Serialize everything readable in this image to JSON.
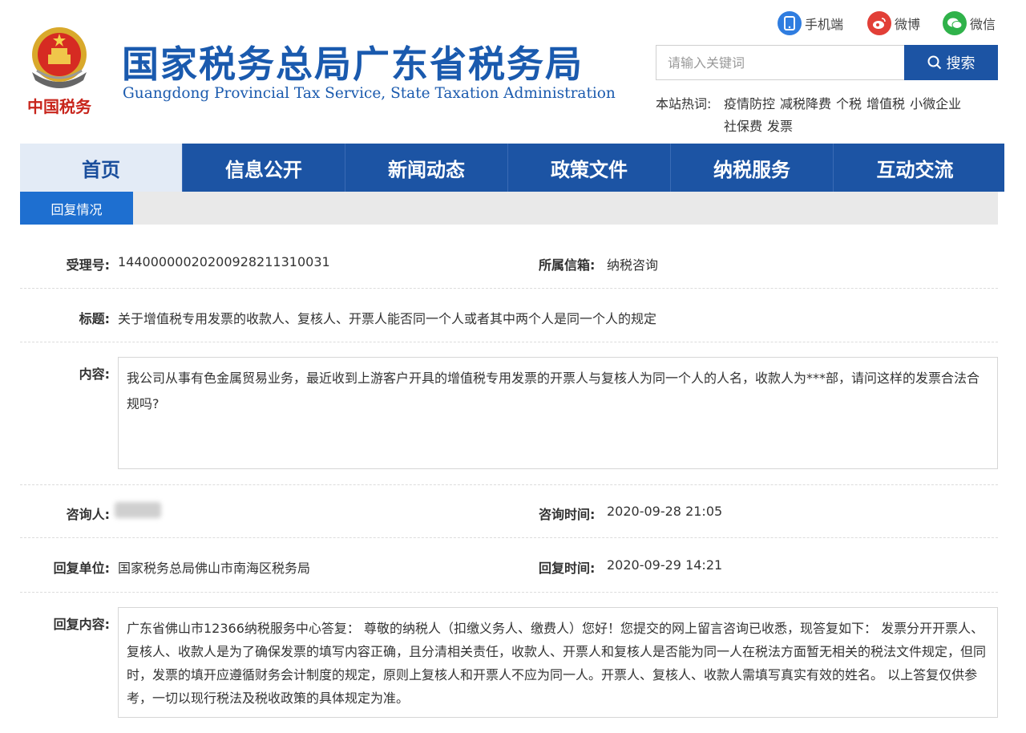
{
  "header": {
    "title_cn": "国家税务总局广东省税务局",
    "title_en": "Guangdong Provincial Tax Service, State Taxation Administration",
    "logo_text": "中国税务",
    "social": {
      "mobile": "手机端",
      "weibo": "微博",
      "wechat": "微信"
    },
    "search": {
      "placeholder": "请输入关键词",
      "button": "搜索"
    },
    "hot": {
      "label": "本站热词:",
      "items": [
        "疫情防控",
        "减税降费",
        "个税",
        "增值税",
        "小微企业",
        "社保费",
        "发票"
      ]
    }
  },
  "nav": {
    "items": [
      "首页",
      "信息公开",
      "新闻动态",
      "政策文件",
      "纳税服务",
      "互动交流"
    ],
    "active_index": 0
  },
  "subtab": "回复情况",
  "detail": {
    "accept_no_label": "受理号:",
    "accept_no": "14400000020200928211310031",
    "mailbox_label": "所属信箱:",
    "mailbox": "纳税咨询",
    "title_label": "标题:",
    "title": "关于增值税专用发票的收款人、复核人、开票人能否同一个人或者其中两个人是同一个人的规定",
    "content_label": "内容:",
    "content": "我公司从事有色金属贸易业务，最近收到上游客户开具的增值税专用发票的开票人与复核人为同一个人的人名，收款人为***部，请问这样的发票合法合规吗?",
    "asker_label": "咨询人:",
    "ask_time_label": "咨询时间:",
    "ask_time": "2020-09-28 21:05",
    "reply_unit_label": "回复单位:",
    "reply_unit": "国家税务总局佛山市南海区税务局",
    "reply_time_label": "回复时间:",
    "reply_time": "2020-09-29 14:21",
    "reply_content_label": "回复内容:",
    "reply_content": "广东省佛山市12366纳税服务中心答复： 尊敬的纳税人（扣缴义务人、缴费人）您好！您提交的网上留言咨询已收悉，现答复如下： 发票分开开票人、复核人、收款人是为了确保发票的填写内容正确，且分清相关责任，收款人、开票人和复核人是否能为同一人在税法方面暂无相关的税法文件规定，但同时，发票的填开应遵循财务会计制度的规定，原则上复核人和开票人不应为同一人。开票人、复核人、收款人需填写真实有效的姓名。 以上答复仅供参考，一切以现行税法及税收政策的具体规定为准。"
  },
  "colors": {
    "brand_blue": "#1c54a4",
    "title_blue": "#1a5aae",
    "subtab_blue": "#1e6fd0"
  }
}
